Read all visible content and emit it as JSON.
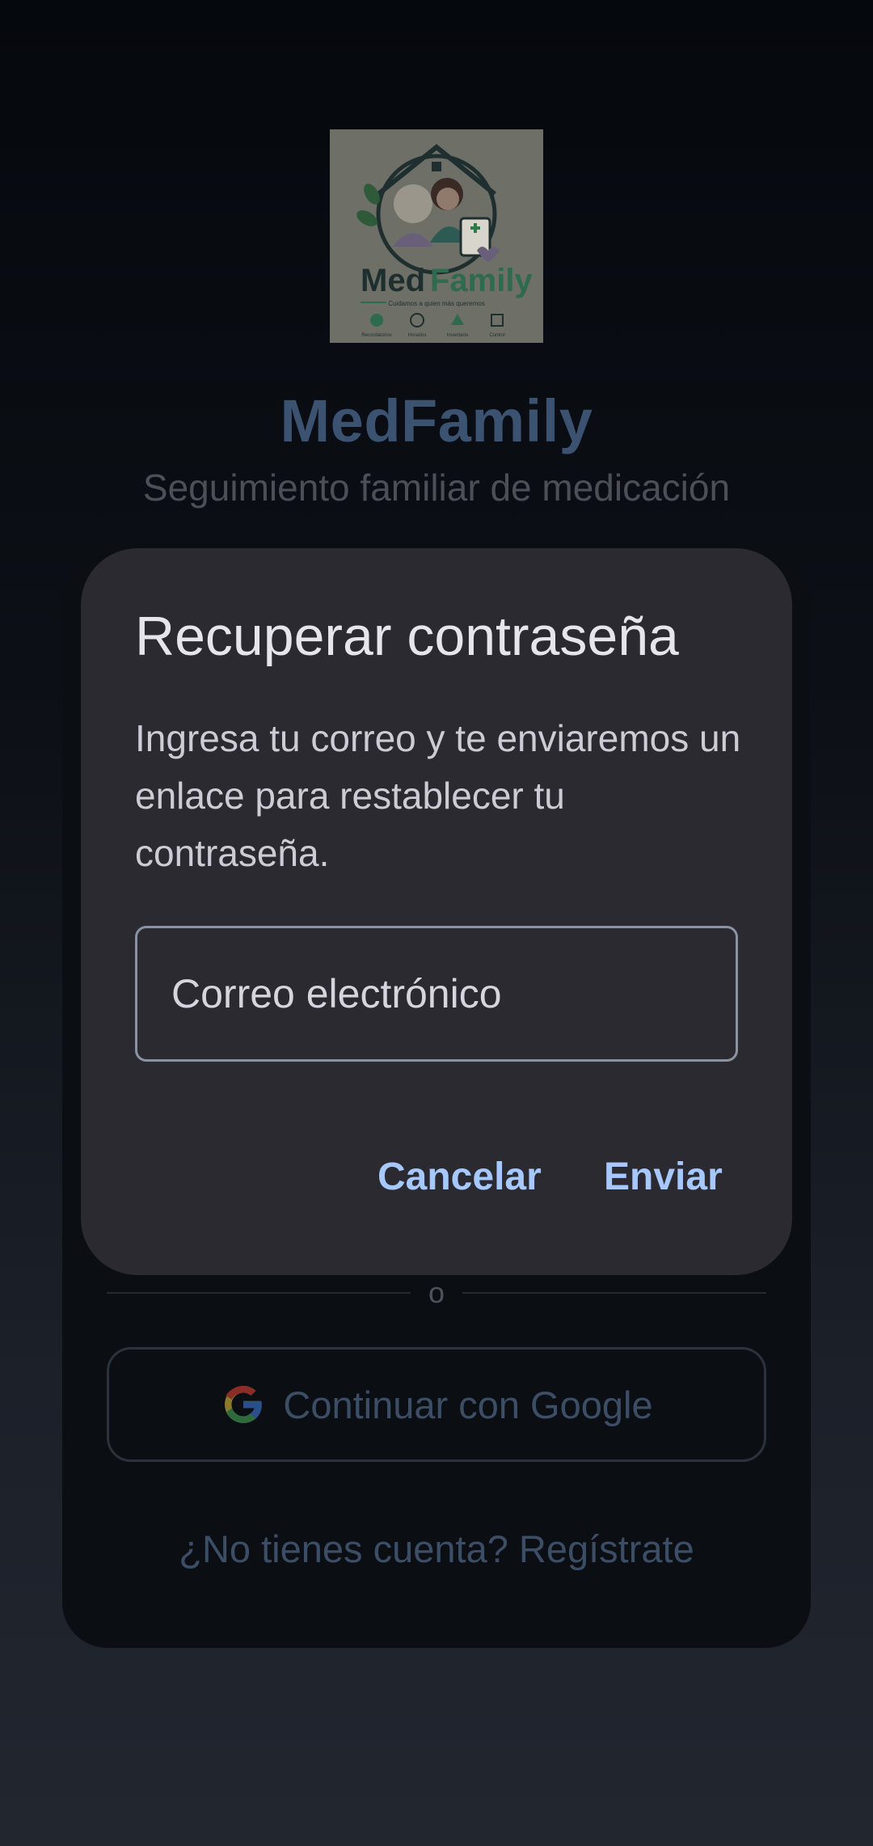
{
  "app": {
    "title": "MedFamily",
    "subtitle": "Seguimiento familiar de medicación",
    "logo": {
      "brand_part1": "Med",
      "brand_part2": "Family",
      "tagline": "Cuidamos a quien más queremos",
      "features": [
        "Recordatorios",
        "Horarios",
        "Inventario",
        "Control"
      ]
    }
  },
  "login": {
    "divider_text": "o",
    "google_button": "Continuar con Google",
    "register_link": "¿No tienes cuenta? Regístrate"
  },
  "dialog": {
    "title": "Recuperar contraseña",
    "message": "Ingresa tu correo y te enviaremos un enlace para restablecer tu contraseña.",
    "email_placeholder": "Correo electrónico",
    "cancel_label": "Cancelar",
    "send_label": "Enviar"
  },
  "colors": {
    "accent": "#a6c8ff",
    "dialog_bg": "#2a2a30",
    "title_dim": "#3b5270"
  }
}
